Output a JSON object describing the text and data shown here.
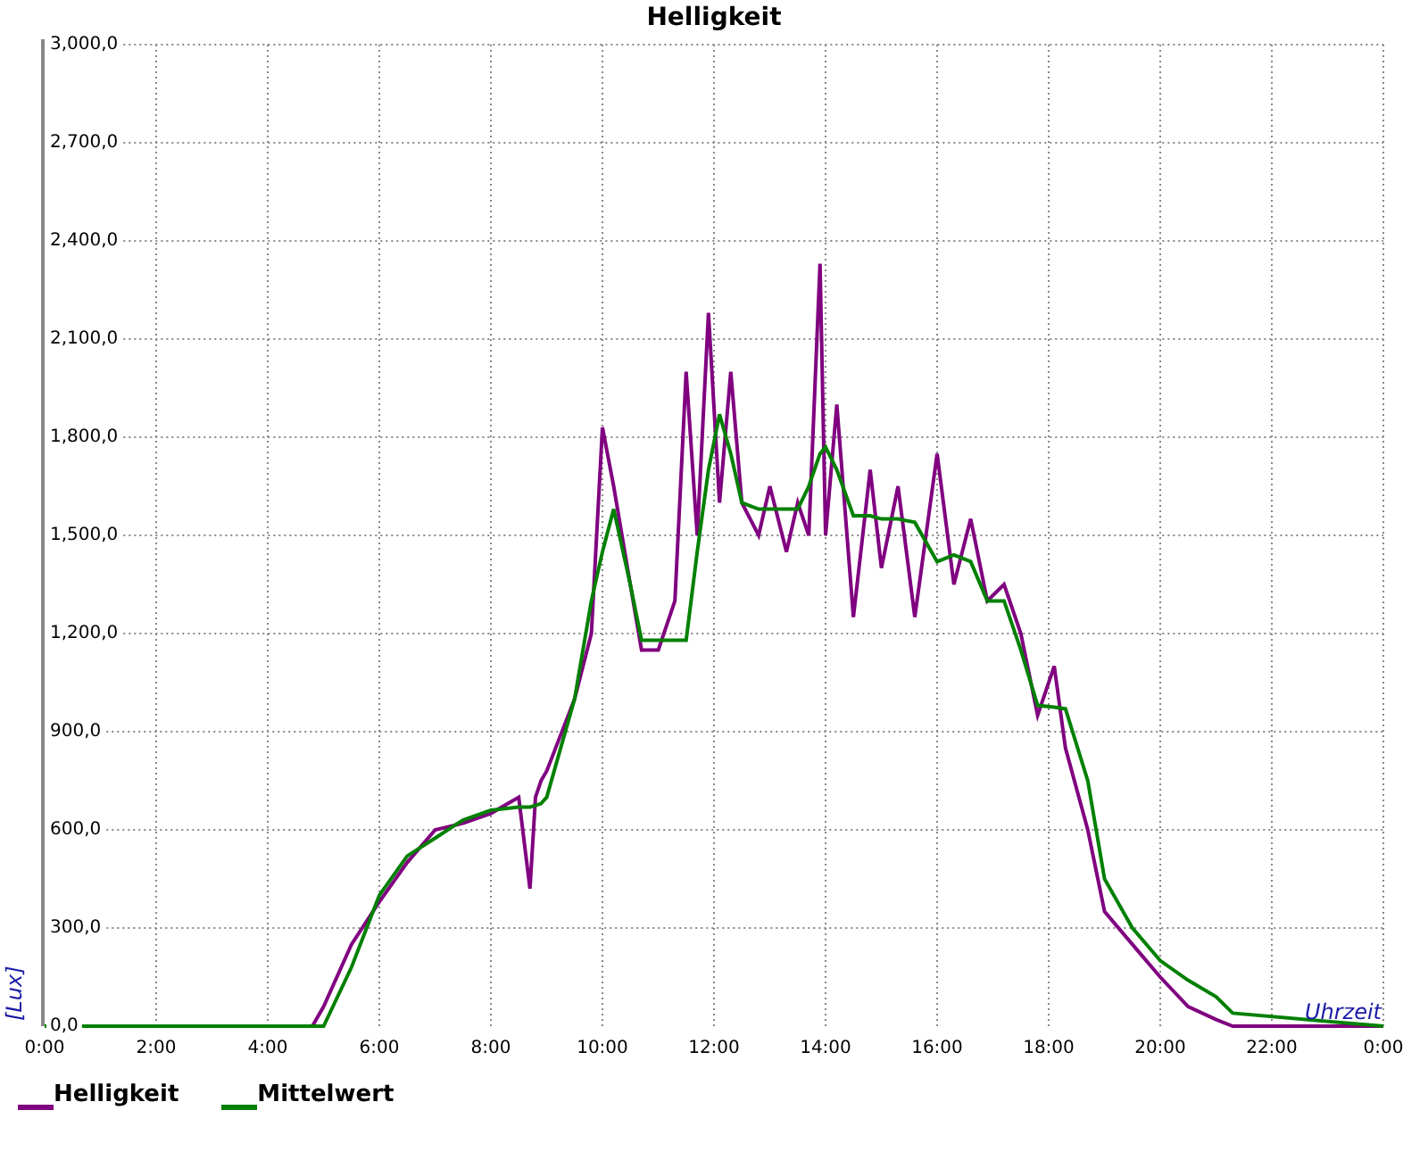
{
  "chart_data": {
    "type": "line",
    "title": "Helligkeit",
    "xlabel": "Uhrzeit",
    "ylabel": "[Lux]",
    "grid": true,
    "legend": true,
    "xlim": [
      0,
      24
    ],
    "ylim": [
      0,
      3000
    ],
    "xticks": [
      {
        "value": 0,
        "label": "0:00"
      },
      {
        "value": 2,
        "label": "2:00"
      },
      {
        "value": 4,
        "label": "4:00"
      },
      {
        "value": 6,
        "label": "6:00"
      },
      {
        "value": 8,
        "label": "8:00"
      },
      {
        "value": 10,
        "label": "10:00"
      },
      {
        "value": 12,
        "label": "12:00"
      },
      {
        "value": 14,
        "label": "14:00"
      },
      {
        "value": 16,
        "label": "16:00"
      },
      {
        "value": 18,
        "label": "18:00"
      },
      {
        "value": 20,
        "label": "20:00"
      },
      {
        "value": 22,
        "label": "22:00"
      },
      {
        "value": 24,
        "label": "0:00"
      }
    ],
    "yticks": [
      {
        "value": 0,
        "label": "0,0"
      },
      {
        "value": 300,
        "label": "300,0"
      },
      {
        "value": 600,
        "label": "600,0"
      },
      {
        "value": 900,
        "label": "900,0"
      },
      {
        "value": 1200,
        "label": "1,200,0"
      },
      {
        "value": 1500,
        "label": "1,500,0"
      },
      {
        "value": 1800,
        "label": "1,800,0"
      },
      {
        "value": 2100,
        "label": "2,100,0"
      },
      {
        "value": 2400,
        "label": "2,400,0"
      },
      {
        "value": 2700,
        "label": "2,700,0"
      },
      {
        "value": 3000,
        "label": "3,000,0"
      }
    ],
    "x": [
      0,
      4.7,
      4.8,
      5,
      5.5,
      6,
      6.5,
      7,
      7.5,
      8,
      8.5,
      8.7,
      8.8,
      8.9,
      9,
      9.5,
      9.8,
      10,
      10.2,
      10.5,
      10.7,
      11,
      11.3,
      11.5,
      11.7,
      11.9,
      12.1,
      12.3,
      12.5,
      12.8,
      13,
      13.3,
      13.5,
      13.7,
      13.9,
      14,
      14.2,
      14.5,
      14.8,
      15,
      15.3,
      15.6,
      16,
      16.3,
      16.6,
      16.9,
      17.2,
      17.5,
      17.8,
      18.1,
      18.3,
      18.7,
      19,
      19.5,
      20,
      20.5,
      21,
      21.3,
      24
    ],
    "series": [
      {
        "name": "Helligkeit",
        "color": "#800080",
        "values": [
          0,
          0,
          0,
          60,
          250,
          380,
          500,
          600,
          620,
          650,
          700,
          420,
          700,
          750,
          780,
          1000,
          1200,
          1830,
          1650,
          1350,
          1150,
          1150,
          1300,
          2000,
          1500,
          2180,
          1600,
          2000,
          1600,
          1500,
          1650,
          1450,
          1600,
          1500,
          2330,
          1500,
          1900,
          1250,
          1700,
          1400,
          1650,
          1250,
          1750,
          1350,
          1550,
          1300,
          1350,
          1200,
          950,
          1100,
          850,
          600,
          350,
          250,
          150,
          60,
          20,
          0,
          0
        ]
      },
      {
        "name": "Mittelwert",
        "color": "#008000",
        "values": [
          0,
          0,
          0,
          0,
          180,
          400,
          520,
          575,
          630,
          660,
          670,
          670,
          675,
          680,
          700,
          1000,
          1300,
          1450,
          1580,
          1350,
          1180,
          1180,
          1180,
          1180,
          1450,
          1700,
          1870,
          1750,
          1600,
          1580,
          1580,
          1580,
          1580,
          1650,
          1750,
          1770,
          1700,
          1560,
          1560,
          1550,
          1550,
          1540,
          1420,
          1440,
          1420,
          1300,
          1300,
          1150,
          980,
          975,
          970,
          750,
          450,
          300,
          200,
          140,
          90,
          40,
          0
        ]
      }
    ]
  }
}
